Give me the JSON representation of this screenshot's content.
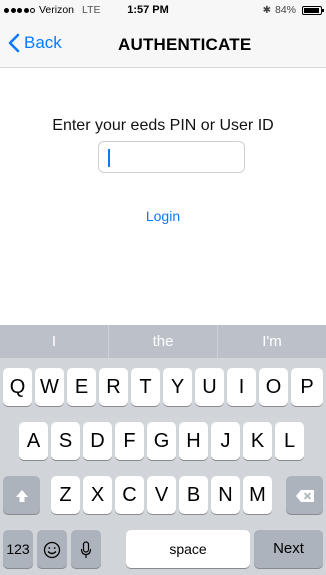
{
  "status_bar": {
    "carrier": "Verizon",
    "network": "LTE",
    "time": "1:57 PM",
    "battery": "84%",
    "battery_level": 0.84,
    "signal_bars_filled": 4,
    "signal_bars_total": 5
  },
  "nav": {
    "back_label": "Back",
    "title": "AUTHENTICATE",
    "accent_color": "#0a7aff"
  },
  "main": {
    "prompt": "Enter your eeds PIN or User ID",
    "input_value": "",
    "login_label": "Login"
  },
  "keyboard": {
    "suggestions": [
      "I",
      "the",
      "I'm"
    ],
    "row1": [
      "Q",
      "W",
      "E",
      "R",
      "T",
      "Y",
      "U",
      "I",
      "O",
      "P"
    ],
    "row2": [
      "A",
      "S",
      "D",
      "F",
      "G",
      "H",
      "J",
      "K",
      "L"
    ],
    "row3": [
      "Z",
      "X",
      "C",
      "V",
      "B",
      "N",
      "M"
    ],
    "numbers_label": "123",
    "space_label": "space",
    "next_label": "Next",
    "icons": {
      "shift": "shift-icon",
      "backspace": "backspace-icon",
      "emoji": "emoji-icon",
      "mic": "microphone-icon"
    }
  }
}
